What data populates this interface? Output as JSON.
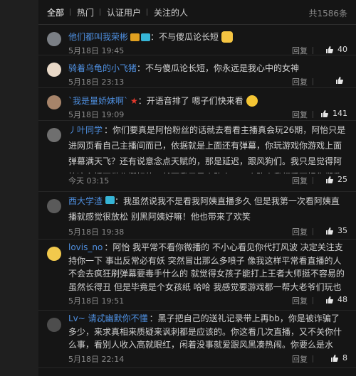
{
  "tabs": [
    "全部",
    "热门",
    "认证用户",
    "关注的人"
  ],
  "total": "共1586条",
  "comments": [
    {
      "user": "他们都叫我荣彬",
      "text": "：不与傻瓜论长短",
      "time": "5月18日 19:45",
      "reply": "回复",
      "likes": "40"
    },
    {
      "user": "骑着乌龟的小飞猪",
      "text": "：不与傻瓜论长短，你永远是我心中的女神",
      "time": "5月18日 23:13",
      "reply": "回复",
      "likes": ""
    },
    {
      "user": "`我是量娇妹啊`",
      "text": "：开语音排了 嗯子们快来看",
      "time": "5月18日 19:09",
      "reply": "回复",
      "likes": "141"
    },
    {
      "user": "丿叶同学",
      "text": "：你们要真是阿怡粉丝的话就去看看主播真会玩26期，阿怡只是进网页看自己主播间而已，依据就是上面还有弹幕，你玩游戏你游戏上面弹幕满天飞？还有说意念点天赋的，那是延迟，跟风狗们。我只是觉得阿怡这主播不做作挺好的，然而我只是个路人，一个路人我都看不惯你们乱j8黑人了",
      "time": "今天 03:15",
      "reply": "回复",
      "likes": "25"
    },
    {
      "user": "西大学渣",
      "text": "：我虽然说我不是看我阿姨直播多久 但是我第一次看阿姨直播就感觉很放松 别黑阿姨好嘛！他也带来了欢笑",
      "time": "5月18日 19:38",
      "reply": "回复",
      "likes": "35"
    },
    {
      "user": "lovis_no",
      "text": "：阿怡 我平常不看你微播的 不小心看见你代打风波 决定关注支持你一下 事出反常必有妖 突然冒出那么多喷子 像我这样平常看直播的人不会去疯狂刷弹幕要毒手什么的 就觉得女孩子能打上王者大师挺不容易的 虽然长得丑 但是毕竟是个女孩纸 哈哈 我感觉要游戏都一帮大老爷们玩也没啥意思 加油吧！不理会就好！",
      "time": "5月18日 19:51",
      "reply": "回复",
      "likes": "48"
    },
    {
      "user": "Lv~ 请忒幽默你不懂",
      "text": "：黑子把自己的送礼记录带上再bb，你是被诈骗了多少，来求真相来质疑来讽刺都是应该的。你这看几次直播，又不关你什么事，看别人收入高就眼红，闲着没事就爱跟风黑凑热闹。你要么是水军，不然的话不是欠骂是什么？",
      "time": "5月18日 22:14",
      "reply": "回复",
      "likes": "8"
    }
  ],
  "colors": {
    "bg": "#151515",
    "link": "#4e8fe0",
    "text": "#d0d0d0"
  }
}
